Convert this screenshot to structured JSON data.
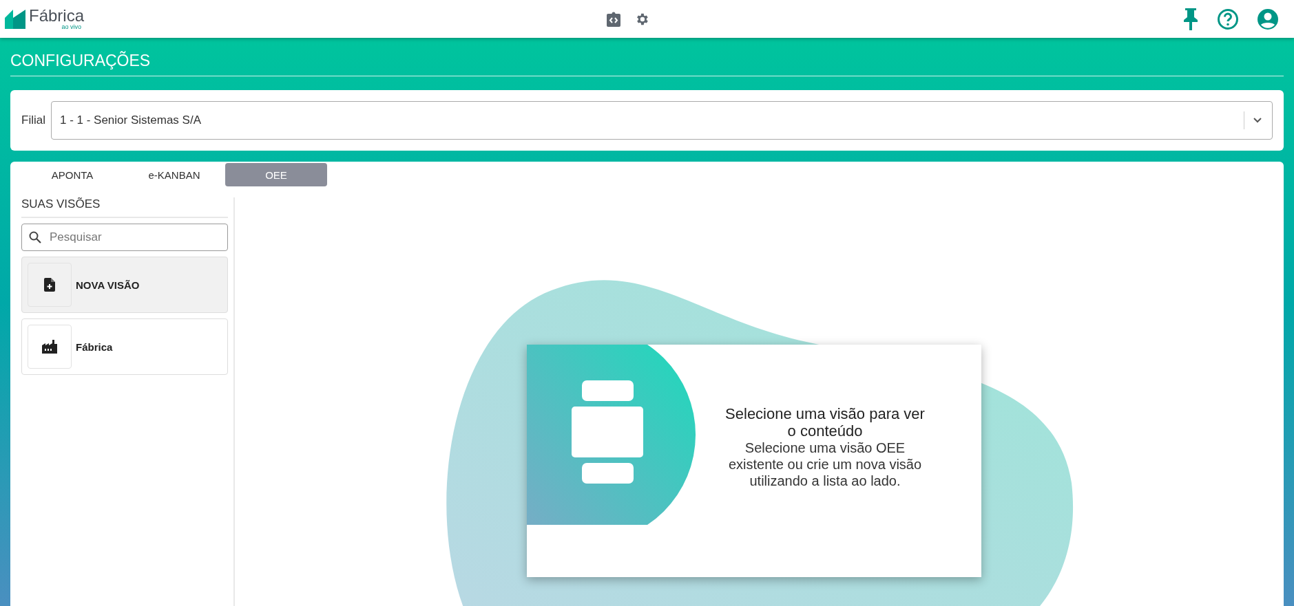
{
  "header": {
    "logo": {
      "name": "Fábrica",
      "tagline": "ao vivo"
    }
  },
  "page": {
    "title": "CONFIGURAÇÕES"
  },
  "filter": {
    "label": "Filial",
    "value": "1 - 1 - Senior Sistemas S/A"
  },
  "tabs": [
    {
      "label": "APONTA",
      "selected": false
    },
    {
      "label": "e-KANBAN",
      "selected": false
    },
    {
      "label": "OEE",
      "selected": true
    }
  ],
  "sidebar": {
    "title": "SUAS VISÕES",
    "search": {
      "placeholder": "Pesquisar"
    },
    "items": [
      {
        "label": "NOVA VISÃO",
        "kind": "new",
        "selected": true
      },
      {
        "label": "Fábrica",
        "kind": "factory",
        "selected": false
      }
    ]
  },
  "empty_state": {
    "title": "Selecione uma visão para ver o conteúdo",
    "message": "Selecione uma visão OEE existente ou crie um nova visão utilizando a lista ao lado."
  }
}
